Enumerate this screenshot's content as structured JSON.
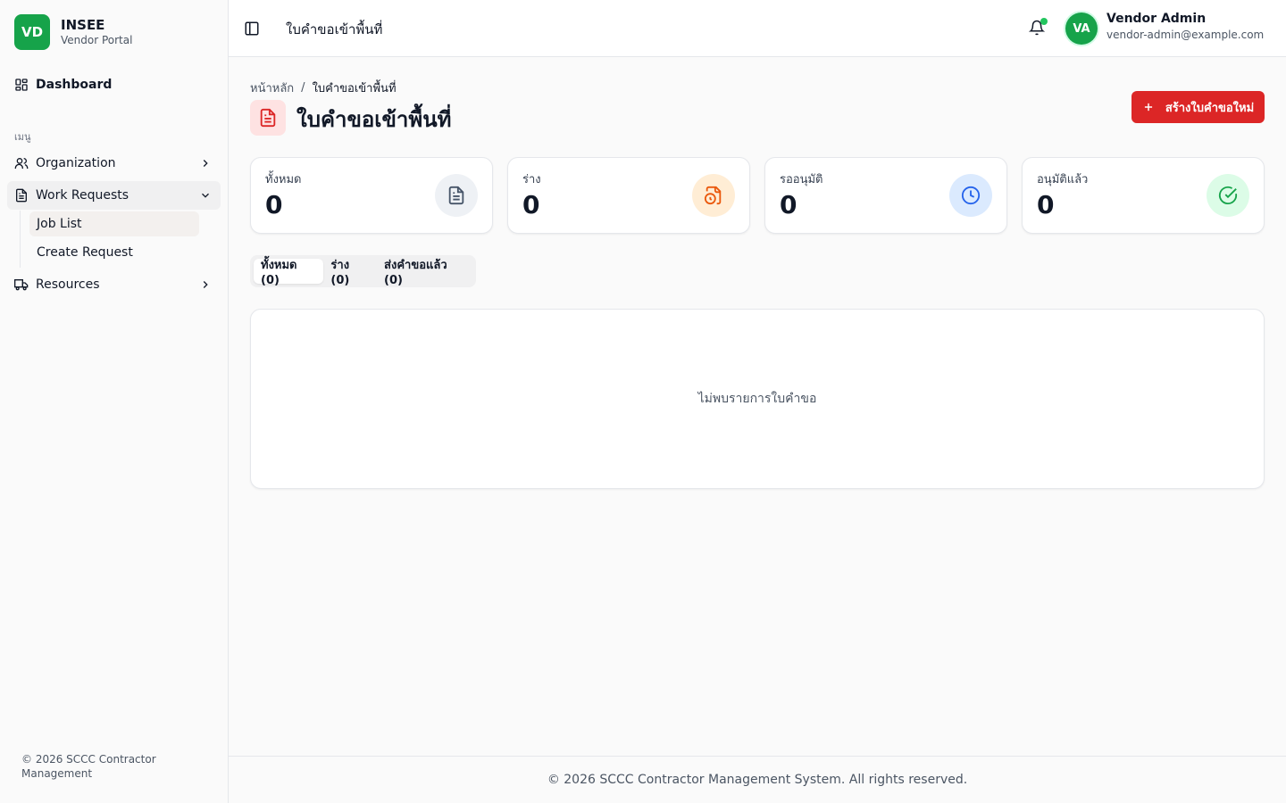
{
  "brand": {
    "logo_text": "VD",
    "name": "INSEE",
    "subtitle": "Vendor Portal",
    "color": "#16a34a"
  },
  "sidebar": {
    "dashboard": {
      "label": "Dashboard",
      "icon": "dashboard-icon"
    },
    "section_label": "เมนู",
    "items": [
      {
        "label": "Organization",
        "icon": "users-icon",
        "expanded": false
      },
      {
        "label": "Work Requests",
        "icon": "file-text-icon",
        "expanded": true,
        "children": [
          {
            "label": "Job List",
            "active": true
          },
          {
            "label": "Create Request",
            "active": false
          }
        ]
      },
      {
        "label": "Resources",
        "icon": "truck-icon",
        "expanded": false
      }
    ],
    "footer": "© 2026 SCCC Contractor Management"
  },
  "header": {
    "title": "ใบคำขอเข้าพื้นที่",
    "notification_icon": "bell-icon",
    "notification_status_color": "#22c55e",
    "user": {
      "initials": "VA",
      "name": "Vendor Admin",
      "email": "vendor-admin@example.com"
    }
  },
  "page": {
    "breadcrumb": {
      "home": "หน้าหลัก",
      "separator": "/",
      "current": "ใบคำขอเข้าพื้นที่"
    },
    "title": "ใบคำขอเข้าพื้นที่",
    "title_icon": "file-text-icon",
    "create_button": {
      "icon": "plus-icon",
      "label": "สร้างใบคำขอใหม่",
      "color": "#dc2626"
    },
    "stats": [
      {
        "label": "ทั้งหมด",
        "value": "0",
        "icon": "file-text-icon",
        "icon_bg": "#eef1f5",
        "icon_color": "#475569"
      },
      {
        "label": "ร่าง",
        "value": "0",
        "icon": "file-clock-icon",
        "icon_bg": "#ffedd5",
        "icon_color": "#ea580c"
      },
      {
        "label": "รออนุมัติ",
        "value": "0",
        "icon": "clock-icon",
        "icon_bg": "#dbeafe",
        "icon_color": "#2563eb"
      },
      {
        "label": "อนุมัติแล้ว",
        "value": "0",
        "icon": "check-circle-icon",
        "icon_bg": "#dcfce7",
        "icon_color": "#16a34a"
      }
    ],
    "tabs": [
      {
        "label": "ทั้งหมด (0)",
        "active": true
      },
      {
        "label": "ร่าง (0)",
        "active": false
      },
      {
        "label": "ส่งคำขอแล้ว (0)",
        "active": false
      }
    ],
    "empty_message": "ไม่พบรายการใบคำขอ"
  },
  "footer": "© 2026 SCCC Contractor Management System. All rights reserved."
}
